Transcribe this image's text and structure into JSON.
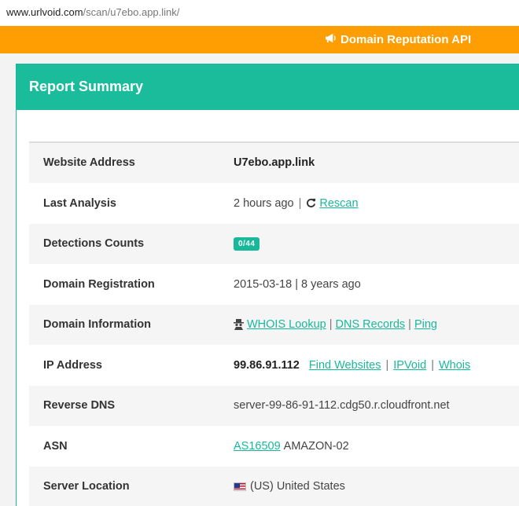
{
  "browser": {
    "url_host": "www.urlvoid.com",
    "url_path": "/scan/u7ebo.app.link/"
  },
  "topbar": {
    "api_label": "Domain Reputation API",
    "api_icon": "megaphone-icon",
    "color": "#ff9e02"
  },
  "card": {
    "title": "Report Summary",
    "accent": "#1abc9c"
  },
  "report": {
    "website_address": {
      "label": "Website Address",
      "value": "U7ebo.app.link"
    },
    "last_analysis": {
      "label": "Last Analysis",
      "value": "2 hours ago",
      "sep": "|",
      "rescan": "Rescan",
      "icon": "refresh-icon"
    },
    "detections": {
      "label": "Detections Counts",
      "badge": "0/44"
    },
    "domain_registration": {
      "label": "Domain Registration",
      "value": "2015-03-18 | 8 years ago"
    },
    "domain_information": {
      "label": "Domain Information",
      "icon": "spy-icon",
      "whois": "WHOIS Lookup",
      "dns": "DNS Records",
      "ping": "Ping",
      "sep": "|"
    },
    "ip_address": {
      "label": "IP Address",
      "ip": "99.86.91.112",
      "find": "Find Websites",
      "ipvoid": "IPVoid",
      "whois": "Whois",
      "sep": "|"
    },
    "reverse_dns": {
      "label": "Reverse DNS",
      "value": "server-99-86-91-112.cdg50.r.cloudfront.net"
    },
    "asn": {
      "label": "ASN",
      "asn_link": "AS16509",
      "asn_name": "AMAZON-02"
    },
    "server_location": {
      "label": "Server Location",
      "flag": "us-flag-icon",
      "value": "(US) United States"
    }
  }
}
